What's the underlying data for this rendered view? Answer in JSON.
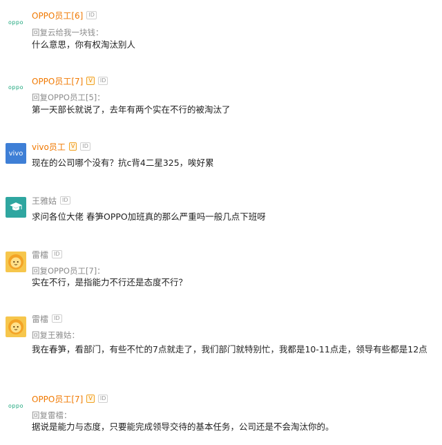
{
  "comments": [
    {
      "avatar": "oppo",
      "avatar_text": "oppo",
      "name": "OPPO员工[6]",
      "verified": false,
      "id_badge": "ID",
      "reply_to": "回复云给我一块钱：",
      "text": "什么意思，你有权淘汰别人"
    },
    {
      "avatar": "oppo",
      "avatar_text": "oppo",
      "name": "OPPO员工[7]",
      "verified": true,
      "v_badge": "V",
      "id_badge": "ID",
      "reply_to": "回复OPPO员工[5]：",
      "text": "第一天部长就说了，去年有两个实在不行的被淘汰了"
    },
    {
      "avatar": "vivo",
      "avatar_text": "vivo",
      "name": "vivo员工",
      "verified": true,
      "v_badge": "V",
      "id_badge": "ID",
      "reply_to": "",
      "text": "现在的公司哪个没有？抗c背4二星325，唉好累"
    },
    {
      "avatar": "cap",
      "name": "王雅姑",
      "verified": false,
      "id_badge": "ID",
      "reply_to": "",
      "text": "求问各位大佬 春笋OPPO加班真的那么严重吗一般几点下班呀"
    },
    {
      "avatar": "lion",
      "name": "雷檑",
      "verified": false,
      "id_badge": "ID",
      "reply_to": "回复OPPO员工[7]：",
      "text": "实在不行，是指能力不行还是态度不行？"
    },
    {
      "avatar": "lion",
      "name": "雷檑",
      "verified": false,
      "id_badge": "ID",
      "reply_to": "回复王雅姑：",
      "text": "我在春笋，看部门，有些不忙的7点就走了，我们部门就特别忙，我都是10-11点走，领导有些都是12点"
    },
    {
      "avatar": "oppo",
      "avatar_text": "oppo",
      "name": "OPPO员工[7]",
      "verified": true,
      "v_badge": "V",
      "id_badge": "ID",
      "reply_to": "回复雷檑：",
      "text": "据说是能力与态度，只要能完成领导交待的基本任务，公司还是不会淘汰你的。"
    }
  ]
}
